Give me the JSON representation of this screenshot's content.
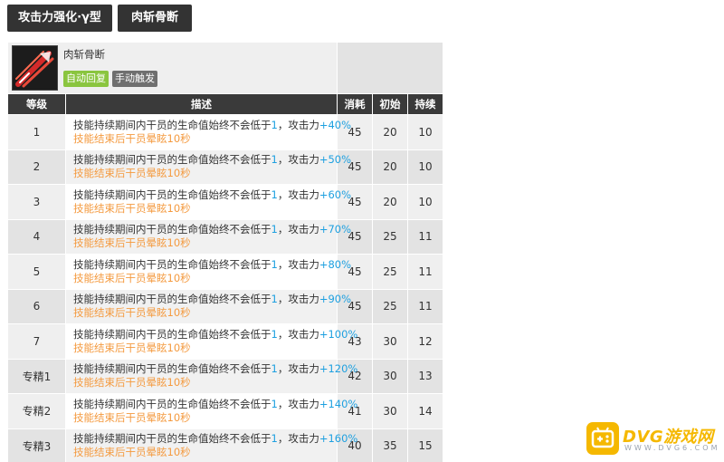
{
  "tabs": [
    "攻击力强化·γ型",
    "肉斩骨断"
  ],
  "skill": {
    "name": "肉斩骨断",
    "badges": [
      "自动回复",
      "手动触发"
    ]
  },
  "columns": [
    "等级",
    "描述",
    "消耗",
    "初始",
    "持续"
  ],
  "rows": [
    {
      "level": "1",
      "desc_prefix": "技能持续期间内干员的生命值始终不会低于",
      "hp": "1",
      "desc_mid": "，攻击力",
      "atk": "+40%",
      "desc2": "技能结束后干员晕眩10秒",
      "cost": "45",
      "init": "20",
      "dur": "10"
    },
    {
      "level": "2",
      "desc_prefix": "技能持续期间内干员的生命值始终不会低于",
      "hp": "1",
      "desc_mid": "，攻击力",
      "atk": "+50%",
      "desc2": "技能结束后干员晕眩10秒",
      "cost": "45",
      "init": "20",
      "dur": "10"
    },
    {
      "level": "3",
      "desc_prefix": "技能持续期间内干员的生命值始终不会低于",
      "hp": "1",
      "desc_mid": "，攻击力",
      "atk": "+60%",
      "desc2": "技能结束后干员晕眩10秒",
      "cost": "45",
      "init": "20",
      "dur": "10"
    },
    {
      "level": "4",
      "desc_prefix": "技能持续期间内干员的生命值始终不会低于",
      "hp": "1",
      "desc_mid": "，攻击力",
      "atk": "+70%",
      "desc2": "技能结束后干员晕眩10秒",
      "cost": "45",
      "init": "25",
      "dur": "11"
    },
    {
      "level": "5",
      "desc_prefix": "技能持续期间内干员的生命值始终不会低于",
      "hp": "1",
      "desc_mid": "，攻击力",
      "atk": "+80%",
      "desc2": "技能结束后干员晕眩10秒",
      "cost": "45",
      "init": "25",
      "dur": "11"
    },
    {
      "level": "6",
      "desc_prefix": "技能持续期间内干员的生命值始终不会低于",
      "hp": "1",
      "desc_mid": "，攻击力",
      "atk": "+90%",
      "desc2": "技能结束后干员晕眩10秒",
      "cost": "45",
      "init": "25",
      "dur": "11"
    },
    {
      "level": "7",
      "desc_prefix": "技能持续期间内干员的生命值始终不会低于",
      "hp": "1",
      "desc_mid": "，攻击力",
      "atk": "+100%",
      "desc2": "技能结束后干员晕眩10秒",
      "cost": "43",
      "init": "30",
      "dur": "12"
    },
    {
      "level": "专精1",
      "desc_prefix": "技能持续期间内干员的生命值始终不会低于",
      "hp": "1",
      "desc_mid": "，攻击力",
      "atk": "+120%",
      "desc2": "技能结束后干员晕眩10秒",
      "cost": "42",
      "init": "30",
      "dur": "13"
    },
    {
      "level": "专精2",
      "desc_prefix": "技能持续期间内干员的生命值始终不会低于",
      "hp": "1",
      "desc_mid": "，攻击力",
      "atk": "+140%",
      "desc2": "技能结束后干员晕眩10秒",
      "cost": "41",
      "init": "30",
      "dur": "14"
    },
    {
      "level": "专精3",
      "desc_prefix": "技能持续期间内干员的生命值始终不会低于",
      "hp": "1",
      "desc_mid": "，攻击力",
      "atk": "+160%",
      "desc2": "技能结束后干员晕眩10秒",
      "cost": "40",
      "init": "35",
      "dur": "15"
    }
  ],
  "watermark": {
    "text": "DVG游戏网",
    "url": "WWW.DVG6.COM"
  },
  "colors": {
    "tab_bg": "#333333",
    "header_bg": "#3a3a3a",
    "highlight_blue": "#1ea0e0",
    "orange_text": "#f49a3f",
    "badge_green": "#8ac53f",
    "badge_grey": "#6f6f6f",
    "watermark_yellow": "#f5b800"
  },
  "icons": {
    "skill_icon": "sword-slash-icon",
    "watermark_logo": "gamepad-icon"
  }
}
